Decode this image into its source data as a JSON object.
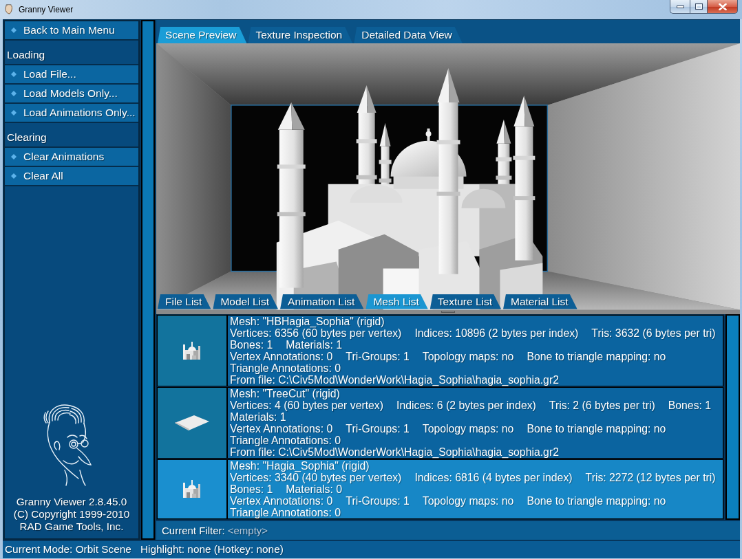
{
  "window": {
    "title": "Granny Viewer"
  },
  "sidebar": {
    "items": [
      {
        "kind": "button",
        "label": "Back to Main Menu"
      },
      {
        "kind": "header",
        "label": "Loading"
      },
      {
        "kind": "button",
        "label": "Load File..."
      },
      {
        "kind": "button",
        "label": "Load Models Only..."
      },
      {
        "kind": "button",
        "label": "Load Animations Only..."
      },
      {
        "kind": "header",
        "label": "Clearing"
      },
      {
        "kind": "button",
        "label": "Clear Animations"
      },
      {
        "kind": "button",
        "label": "Clear All"
      }
    ],
    "about": [
      "Granny Viewer 2.8.45.0",
      "(C) Copyright 1999-2010",
      "RAD Game Tools, Inc."
    ]
  },
  "top_tabs": [
    {
      "label": "Scene Preview",
      "selected": true
    },
    {
      "label": "Texture Inspection",
      "selected": false
    },
    {
      "label": "Detailed Data View",
      "selected": false
    }
  ],
  "list_tabs": [
    {
      "label": "File List",
      "selected": false
    },
    {
      "label": "Model List",
      "selected": false
    },
    {
      "label": "Animation List",
      "selected": false
    },
    {
      "label": "Mesh List",
      "selected": true
    },
    {
      "label": "Texture List",
      "selected": false
    },
    {
      "label": "Material List",
      "selected": false
    }
  ],
  "mesh_list": {
    "rows": [
      {
        "kind": "building",
        "selected": false,
        "title": "Mesh: \"HBHagia_Sophia\" (rigid)",
        "groups": [
          [
            "Vertices: 6356 (60 bytes per vertex)",
            "Indices: 10896 (2 bytes per index)",
            "Tris: 3632 (6 bytes per tri)",
            "Bones: 1",
            "Materials: 1"
          ],
          [
            "Vertex Annotations: 0",
            "Tri-Groups: 1",
            "Topology maps: no",
            "Bone to triangle mapping: no"
          ],
          [
            "Triangle Annotations: 0"
          ],
          [
            "From file: C:\\Civ5Mod\\WonderWork\\Hagia_Sophia\\hagia_sophia.gr2"
          ]
        ]
      },
      {
        "kind": "plane",
        "selected": false,
        "title": "Mesh: \"TreeCut\" (rigid)",
        "groups": [
          [
            "Vertices: 4 (60 bytes per vertex)",
            "Indices: 6 (2 bytes per index)",
            "Tris: 2 (6 bytes per tri)",
            "Bones: 1",
            "Materials: 1"
          ],
          [
            "Vertex Annotations: 0",
            "Tri-Groups: 1",
            "Topology maps: no",
            "Bone to triangle mapping: no"
          ],
          [
            "Triangle Annotations: 0"
          ],
          [
            "From file: C:\\Civ5Mod\\WonderWork\\Hagia_Sophia\\hagia_sophia.gr2"
          ]
        ]
      },
      {
        "kind": "building",
        "selected": true,
        "title": "Mesh: \"Hagia_Sophia\" (rigid)",
        "groups": [
          [
            "Vertices: 3340 (40 bytes per vertex)",
            "Indices: 6816 (4 bytes per index)",
            "Tris: 2272 (12 bytes per tri)",
            "Bones: 1",
            "Materials: 0"
          ],
          [
            "Vertex Annotations: 0",
            "Tri-Groups: 1",
            "Topology maps: no",
            "Bone to triangle mapping: no"
          ],
          [
            "Triangle Annotations: 0"
          ]
        ]
      }
    ]
  },
  "filter": {
    "label": "Current Filter:",
    "value": "<empty>"
  },
  "status_bar": {
    "mode": "Current Mode: Orbit Scene",
    "highlight": "Highlight: none (Hotkey: none)"
  }
}
